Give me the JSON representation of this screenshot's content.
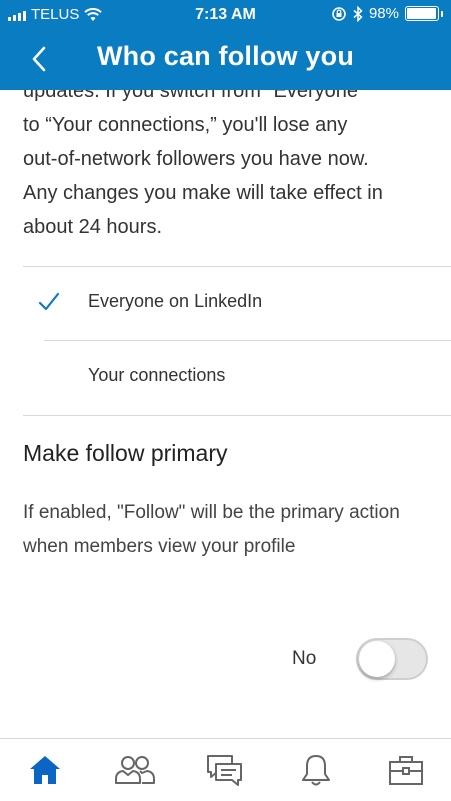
{
  "status_bar": {
    "carrier": "TELUS",
    "time": "7:13 AM",
    "battery": "98%",
    "battery_level": 0.98
  },
  "header": {
    "title": "Who can follow you"
  },
  "description": {
    "lines": [
      "updates. If you switch from \"Everyone",
      "to “Your connections,” you'll lose any",
      "out-of-network followers you have now.",
      "Any changes you make will take effect in",
      "about 24 hours."
    ]
  },
  "follow_options": [
    {
      "label": "Everyone on LinkedIn",
      "selected": true
    },
    {
      "label": "Your connections",
      "selected": false
    }
  ],
  "make_follow_primary": {
    "title": "Make follow primary",
    "description": "If enabled, \"Follow\" will be the primary action when members view your profile",
    "toggle_label": "No",
    "enabled": false
  },
  "tab_bar": {
    "items": [
      {
        "icon": "home-icon",
        "active": true
      },
      {
        "icon": "network-icon",
        "active": false
      },
      {
        "icon": "messaging-icon",
        "active": false
      },
      {
        "icon": "notifications-icon",
        "active": false
      },
      {
        "icon": "jobs-icon",
        "active": false
      }
    ]
  },
  "colors": {
    "brand_blue": "#0a7dc2",
    "active_tab": "#0a66c2",
    "inactive_tab": "#666666",
    "check": "#0a7dc2"
  }
}
